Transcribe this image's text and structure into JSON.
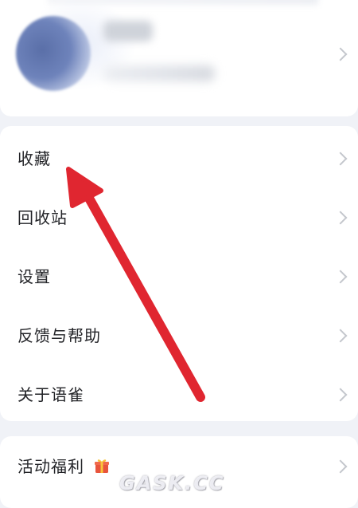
{
  "profile": {
    "avatar_icon": "avatar-icon"
  },
  "menu": {
    "items": [
      {
        "label": "收藏",
        "icon": "chevron-right-icon"
      },
      {
        "label": "回收站",
        "icon": "chevron-right-icon"
      },
      {
        "label": "设置",
        "icon": "chevron-right-icon"
      },
      {
        "label": "反馈与帮助",
        "icon": "chevron-right-icon"
      },
      {
        "label": "关于语雀",
        "icon": "chevron-right-icon"
      }
    ]
  },
  "promo": {
    "label": "活动福利",
    "icon": "gift-icon"
  },
  "watermark": {
    "text": "GASK.CC"
  },
  "annotation": {
    "arrow_color": "#e02630"
  }
}
